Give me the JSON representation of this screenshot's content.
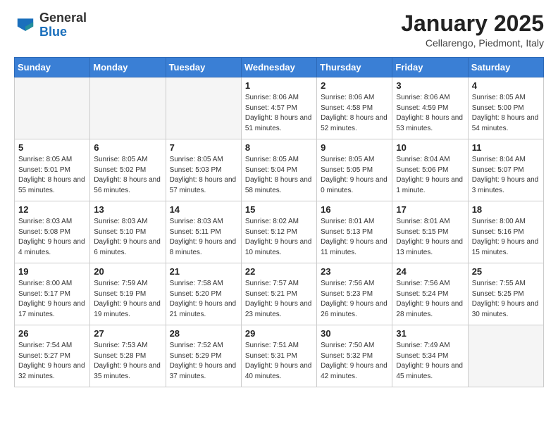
{
  "header": {
    "logo_general": "General",
    "logo_blue": "Blue",
    "month": "January 2025",
    "location": "Cellarengo, Piedmont, Italy"
  },
  "weekdays": [
    "Sunday",
    "Monday",
    "Tuesday",
    "Wednesday",
    "Thursday",
    "Friday",
    "Saturday"
  ],
  "weeks": [
    [
      {
        "day": "",
        "detail": ""
      },
      {
        "day": "",
        "detail": ""
      },
      {
        "day": "",
        "detail": ""
      },
      {
        "day": "1",
        "detail": "Sunrise: 8:06 AM\nSunset: 4:57 PM\nDaylight: 8 hours and 51 minutes."
      },
      {
        "day": "2",
        "detail": "Sunrise: 8:06 AM\nSunset: 4:58 PM\nDaylight: 8 hours and 52 minutes."
      },
      {
        "day": "3",
        "detail": "Sunrise: 8:06 AM\nSunset: 4:59 PM\nDaylight: 8 hours and 53 minutes."
      },
      {
        "day": "4",
        "detail": "Sunrise: 8:05 AM\nSunset: 5:00 PM\nDaylight: 8 hours and 54 minutes."
      }
    ],
    [
      {
        "day": "5",
        "detail": "Sunrise: 8:05 AM\nSunset: 5:01 PM\nDaylight: 8 hours and 55 minutes."
      },
      {
        "day": "6",
        "detail": "Sunrise: 8:05 AM\nSunset: 5:02 PM\nDaylight: 8 hours and 56 minutes."
      },
      {
        "day": "7",
        "detail": "Sunrise: 8:05 AM\nSunset: 5:03 PM\nDaylight: 8 hours and 57 minutes."
      },
      {
        "day": "8",
        "detail": "Sunrise: 8:05 AM\nSunset: 5:04 PM\nDaylight: 8 hours and 58 minutes."
      },
      {
        "day": "9",
        "detail": "Sunrise: 8:05 AM\nSunset: 5:05 PM\nDaylight: 9 hours and 0 minutes."
      },
      {
        "day": "10",
        "detail": "Sunrise: 8:04 AM\nSunset: 5:06 PM\nDaylight: 9 hours and 1 minute."
      },
      {
        "day": "11",
        "detail": "Sunrise: 8:04 AM\nSunset: 5:07 PM\nDaylight: 9 hours and 3 minutes."
      }
    ],
    [
      {
        "day": "12",
        "detail": "Sunrise: 8:03 AM\nSunset: 5:08 PM\nDaylight: 9 hours and 4 minutes."
      },
      {
        "day": "13",
        "detail": "Sunrise: 8:03 AM\nSunset: 5:10 PM\nDaylight: 9 hours and 6 minutes."
      },
      {
        "day": "14",
        "detail": "Sunrise: 8:03 AM\nSunset: 5:11 PM\nDaylight: 9 hours and 8 minutes."
      },
      {
        "day": "15",
        "detail": "Sunrise: 8:02 AM\nSunset: 5:12 PM\nDaylight: 9 hours and 10 minutes."
      },
      {
        "day": "16",
        "detail": "Sunrise: 8:01 AM\nSunset: 5:13 PM\nDaylight: 9 hours and 11 minutes."
      },
      {
        "day": "17",
        "detail": "Sunrise: 8:01 AM\nSunset: 5:15 PM\nDaylight: 9 hours and 13 minutes."
      },
      {
        "day": "18",
        "detail": "Sunrise: 8:00 AM\nSunset: 5:16 PM\nDaylight: 9 hours and 15 minutes."
      }
    ],
    [
      {
        "day": "19",
        "detail": "Sunrise: 8:00 AM\nSunset: 5:17 PM\nDaylight: 9 hours and 17 minutes."
      },
      {
        "day": "20",
        "detail": "Sunrise: 7:59 AM\nSunset: 5:19 PM\nDaylight: 9 hours and 19 minutes."
      },
      {
        "day": "21",
        "detail": "Sunrise: 7:58 AM\nSunset: 5:20 PM\nDaylight: 9 hours and 21 minutes."
      },
      {
        "day": "22",
        "detail": "Sunrise: 7:57 AM\nSunset: 5:21 PM\nDaylight: 9 hours and 23 minutes."
      },
      {
        "day": "23",
        "detail": "Sunrise: 7:56 AM\nSunset: 5:23 PM\nDaylight: 9 hours and 26 minutes."
      },
      {
        "day": "24",
        "detail": "Sunrise: 7:56 AM\nSunset: 5:24 PM\nDaylight: 9 hours and 28 minutes."
      },
      {
        "day": "25",
        "detail": "Sunrise: 7:55 AM\nSunset: 5:25 PM\nDaylight: 9 hours and 30 minutes."
      }
    ],
    [
      {
        "day": "26",
        "detail": "Sunrise: 7:54 AM\nSunset: 5:27 PM\nDaylight: 9 hours and 32 minutes."
      },
      {
        "day": "27",
        "detail": "Sunrise: 7:53 AM\nSunset: 5:28 PM\nDaylight: 9 hours and 35 minutes."
      },
      {
        "day": "28",
        "detail": "Sunrise: 7:52 AM\nSunset: 5:29 PM\nDaylight: 9 hours and 37 minutes."
      },
      {
        "day": "29",
        "detail": "Sunrise: 7:51 AM\nSunset: 5:31 PM\nDaylight: 9 hours and 40 minutes."
      },
      {
        "day": "30",
        "detail": "Sunrise: 7:50 AM\nSunset: 5:32 PM\nDaylight: 9 hours and 42 minutes."
      },
      {
        "day": "31",
        "detail": "Sunrise: 7:49 AM\nSunset: 5:34 PM\nDaylight: 9 hours and 45 minutes."
      },
      {
        "day": "",
        "detail": ""
      }
    ]
  ]
}
